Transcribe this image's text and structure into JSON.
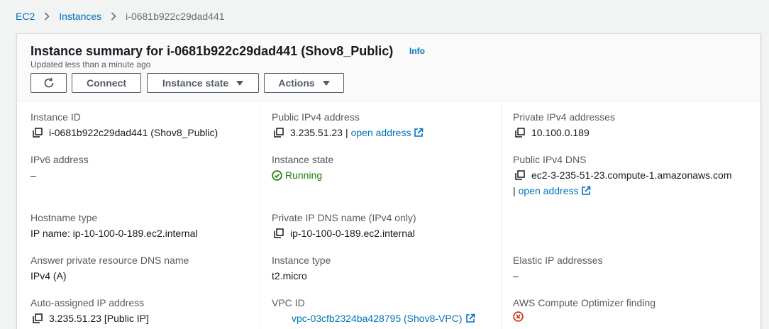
{
  "breadcrumb": {
    "root": "EC2",
    "section": "Instances",
    "current": "i-0681b922c29dad441"
  },
  "header": {
    "title": "Instance summary for i-0681b922c29dad441 (Shov8_Public)",
    "info": "Info",
    "updated": "Updated less than a minute ago"
  },
  "buttons": {
    "connect": "Connect",
    "instance_state": "Instance state",
    "actions": "Actions"
  },
  "col1": {
    "instance_id_label": "Instance ID",
    "instance_id": "i-0681b922c29dad441 (Shov8_Public)",
    "ipv6_label": "IPv6 address",
    "ipv6": "–",
    "hostname_type_label": "Hostname type",
    "hostname_type": "IP name: ip-10-100-0-189.ec2.internal",
    "answer_dns_label": "Answer private resource DNS name",
    "answer_dns": "IPv4 (A)",
    "auto_ip_label": "Auto-assigned IP address",
    "auto_ip": "3.235.51.23 [Public IP]"
  },
  "col2": {
    "public_ipv4_label": "Public IPv4 address",
    "public_ipv4": "3.235.51.23",
    "separator": "|",
    "open_address": "open address",
    "instance_state_label": "Instance state",
    "instance_state": "Running",
    "private_dns_label": "Private IP DNS name (IPv4 only)",
    "private_dns": "ip-10-100-0-189.ec2.internal",
    "instance_type_label": "Instance type",
    "instance_type": "t2.micro",
    "vpc_label": "VPC ID",
    "vpc": "vpc-03cfb2324ba428795 (Shov8-VPC)"
  },
  "col3": {
    "private_ipv4_label": "Private IPv4 addresses",
    "private_ipv4": "10.100.0.189",
    "public_dns_label": "Public IPv4 DNS",
    "public_dns": "ec2-3-235-51-23.compute-1.amazonaws.com",
    "separator": "|",
    "open_address": "open address",
    "elastic_label": "Elastic IP addresses",
    "elastic": "–",
    "optimizer_label": "AWS Compute Optimizer finding"
  },
  "colors": {
    "link": "#0073bb",
    "success": "#1d8102",
    "error": "#d13212",
    "border": "#545b64"
  },
  "icons": {
    "copy": "copy-icon",
    "external": "external-link-icon",
    "refresh": "refresh-icon",
    "status_ok": "check-circle-icon",
    "status_error": "error-circle-icon"
  }
}
